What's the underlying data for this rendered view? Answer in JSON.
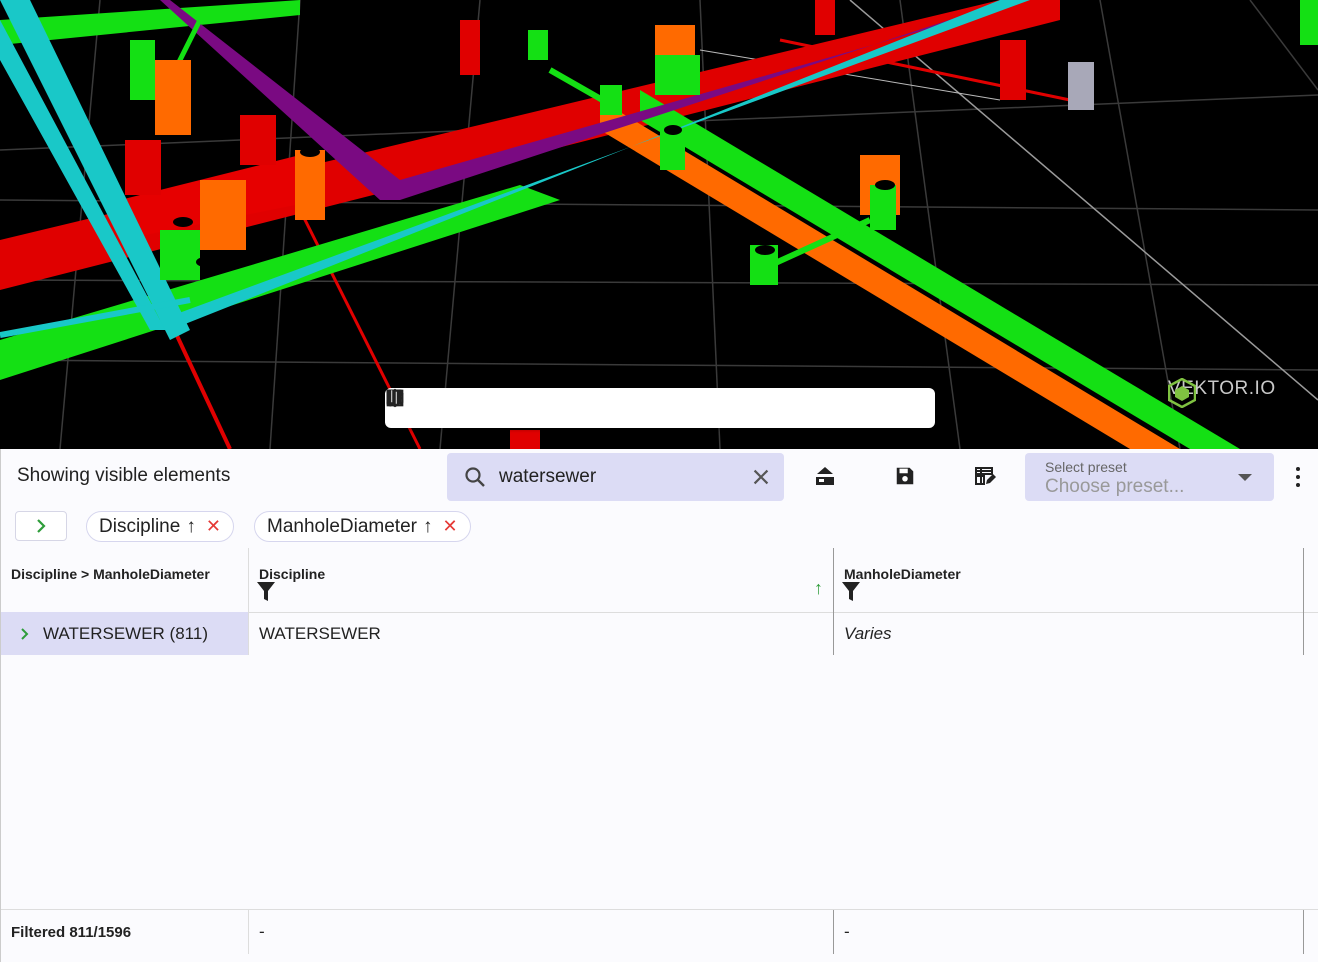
{
  "viewer": {
    "logo_text": "VEKTOR.IO",
    "toolbar": [
      {
        "icon": "undo-icon"
      },
      {
        "icon": "ruler-icon"
      },
      {
        "icon": "section-box-icon"
      },
      {
        "icon": "cube-icon"
      },
      {
        "icon": "zoom-search-icon"
      },
      {
        "icon": "pen-icon"
      },
      {
        "icon": "eraser-icon"
      },
      {
        "icon": "scissors-icon"
      },
      {
        "icon": "rotate-icon"
      },
      {
        "icon": "fit-view-icon"
      },
      {
        "icon": "map-icon"
      }
    ]
  },
  "panel": {
    "title": "Showing visible elements",
    "search": {
      "value": "watersewer",
      "placeholder": "Search"
    },
    "actions": [
      {
        "icon": "layers-save-icon"
      },
      {
        "icon": "save-icon"
      },
      {
        "icon": "table-edit-icon"
      }
    ],
    "preset": {
      "label": "Select preset",
      "placeholder": "Choose preset..."
    },
    "group_chips": [
      {
        "label": "Discipline",
        "sort": "↑"
      },
      {
        "label": "ManholeDiameter",
        "sort": "↑"
      }
    ],
    "columns": [
      {
        "header": "Discipline > ManholeDiameter"
      },
      {
        "header": "Discipline",
        "sort": "↑"
      },
      {
        "header": "ManholeDiameter"
      }
    ],
    "rows": [
      {
        "group": "WATERSEWER (811)",
        "discipline": "WATERSEWER",
        "manhole_diameter": "Varies"
      }
    ],
    "footer": {
      "count": "Filtered 811/1596",
      "discipline": "-",
      "manhole_diameter": "-"
    }
  },
  "colors": {
    "accent": "#dcdcf5",
    "sort_arrow": "#2e9d3a",
    "remove": "#e53935"
  }
}
